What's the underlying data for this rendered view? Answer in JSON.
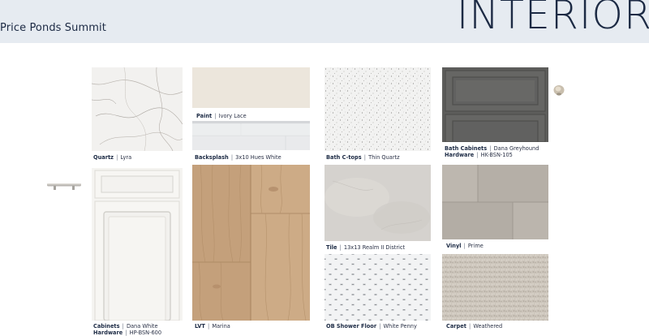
{
  "header": {
    "community": "Price Ponds Summit",
    "section_title": "INTERIOR"
  },
  "items": {
    "quartz": {
      "name": "Quartz",
      "value": "Lyra"
    },
    "paint": {
      "name": "Paint",
      "value": "Ivory Lace"
    },
    "backsplash": {
      "name": "Backsplash",
      "value": "3x10 Hues White"
    },
    "bath_ctops": {
      "name": "Bath C-tops",
      "value": "Thin Quartz"
    },
    "bath_cabinets": {
      "name": "Bath Cabinets",
      "value": "Dana Greyhound"
    },
    "bath_hardware": {
      "name": "Hardware",
      "value": "HK-BSN-105"
    },
    "cabinets": {
      "name": "Cabinets",
      "value": "Dana White"
    },
    "cabinet_hardware": {
      "name": "Hardware",
      "value": "HP-BSN-600"
    },
    "lvt": {
      "name": "LVT",
      "value": "Marina"
    },
    "tile": {
      "name": "Tile",
      "value": "13x13 Realm II District"
    },
    "vinyl": {
      "name": "Vinyl",
      "value": "Prime"
    },
    "ob_shower_floor": {
      "name": "OB Shower Floor",
      "value": "White Penny"
    },
    "carpet": {
      "name": "Carpet",
      "value": "Weathered"
    }
  },
  "separator": "|",
  "colors": {
    "header_bg": "#e6ebf1",
    "navy": "#1c2a44",
    "quartz": "#f1f0ee",
    "paint": "#ece6dc",
    "backsplash": "#e8e9eb",
    "bath_ctops": "#f1f1f0",
    "bath_cabinet": "#5f5f5d",
    "cabinet_white": "#f6f5f2",
    "lvt_wood": "#c9a784",
    "tile": "#d6d3cf",
    "vinyl": "#b8b2aa",
    "penny_grout": "#8e9297",
    "carpet": "#cdc6bc"
  }
}
